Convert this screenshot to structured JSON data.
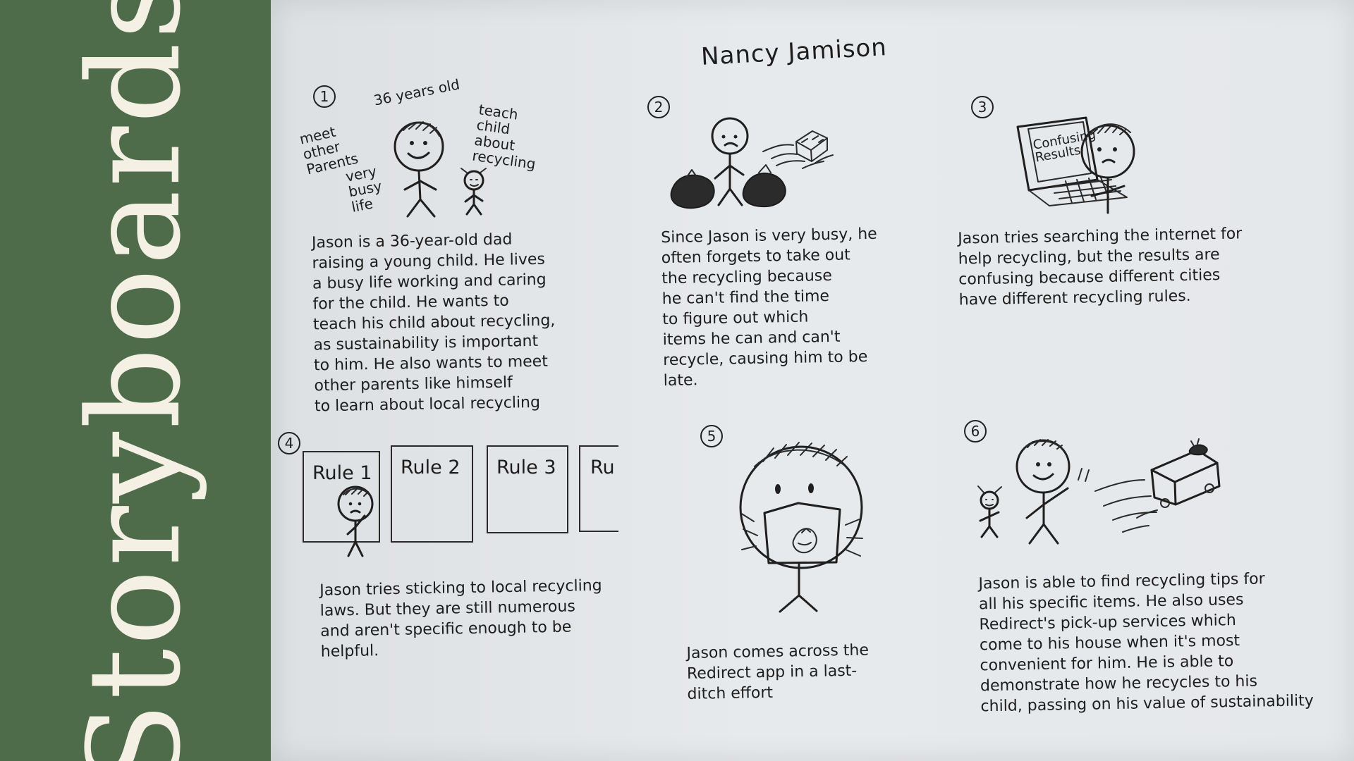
{
  "page": {
    "title": "Storyboards",
    "author": "Nancy Jamison"
  },
  "panels": [
    {
      "number": "1",
      "labels": {
        "age": "36 years old",
        "meet": "meet\nother\nParents",
        "busy": "very\nbusy\nlife",
        "teach": "teach\nchild about\nrecycling"
      },
      "caption": "Jason is a 36-year-old dad\nraising a young child. He lives\na busy life working and caring\nfor the child. He wants to\nteach his child about recycling,\nas sustainability is important\nto him. He also wants to meet\nother parents like himself\nto learn about local recycling"
    },
    {
      "number": "2",
      "caption": "Since Jason is very busy, he\noften forgets to take out\nthe recycling because\nhe can't find the time\nto figure out which\nitems he can and can't\nrecycle, causing him to be\nlate."
    },
    {
      "number": "3",
      "labels": {
        "screen": "Confusing\nResults"
      },
      "caption": "Jason tries searching the internet for\nhelp recycling, but the results are\nconfusing because different cities\nhave different recycling rules."
    },
    {
      "number": "4",
      "rules": [
        "Rule 1",
        "Rule 2",
        "Rule 3",
        "Ru"
      ],
      "caption": "Jason tries sticking to local recycling\nlaws. But they are still numerous\nand aren't specific enough to be\nhelpful."
    },
    {
      "number": "5",
      "caption": "Jason comes across the\nRedirect app in a last-\nditch effort"
    },
    {
      "number": "6",
      "caption": "Jason is able to find recycling tips for\nall his specific items. He also uses\nRedirect's pick-up services which\ncome to his house when it's most\nconvenient for him. He is able to\ndemonstrate how he recycles to his\nchild, passing on his value of sustainability"
    }
  ],
  "colors": {
    "sidebar": "#4e6c4a",
    "title": "#f5f0e4",
    "paper": "#e6e9ec",
    "ink": "#1d1d1d"
  }
}
